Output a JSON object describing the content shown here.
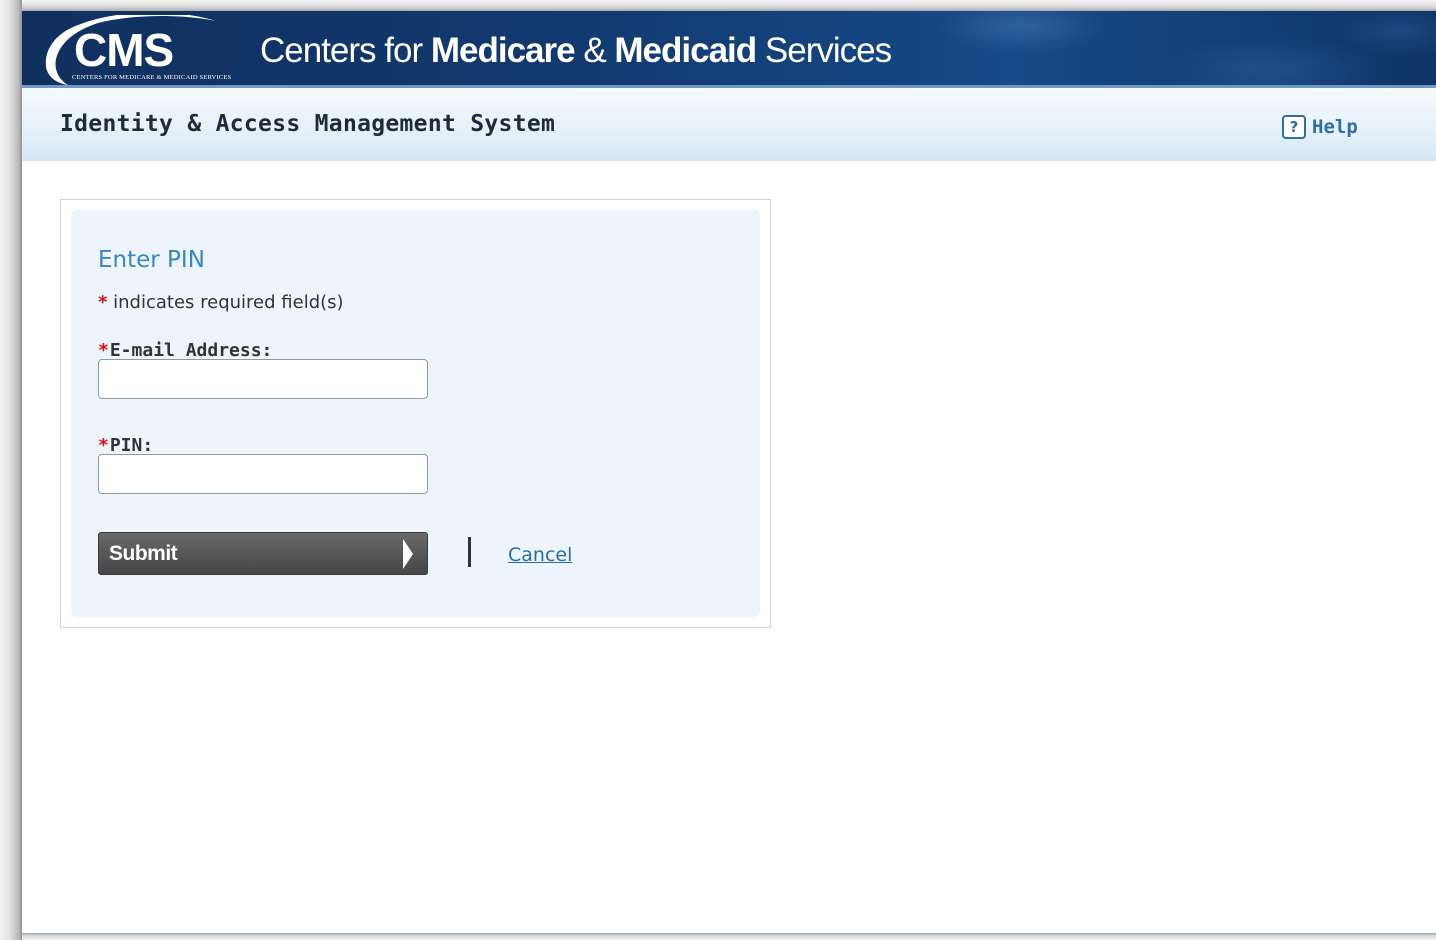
{
  "banner": {
    "logo_text": "CMS",
    "logo_subtext": "CENTERS FOR MEDICARE & MEDICAID SERVICES",
    "agency_parts": [
      "Centers for ",
      "Medicare",
      " & ",
      "Medicaid",
      " Services"
    ]
  },
  "header": {
    "system_title": "Identity & Access Management System",
    "help_icon_glyph": "?",
    "help_label": "Help"
  },
  "form": {
    "title": "Enter PIN",
    "required_star": "*",
    "required_note": " indicates required field(s)",
    "email_label": "E-mail Address:",
    "email_value": "",
    "pin_label": "PIN:",
    "pin_value": "",
    "submit_label": "Submit",
    "cancel_label": "Cancel"
  },
  "colors": {
    "banner_dark": "#10305f",
    "title_accent": "#3a86c2",
    "link": "#2a6ea6",
    "required": "#d0111b",
    "button": "#555555"
  },
  "icons": {
    "help": "question-box-icon",
    "submit_arrow": "arrow-right-icon",
    "logo_swoosh": "cms-swoosh-icon"
  }
}
